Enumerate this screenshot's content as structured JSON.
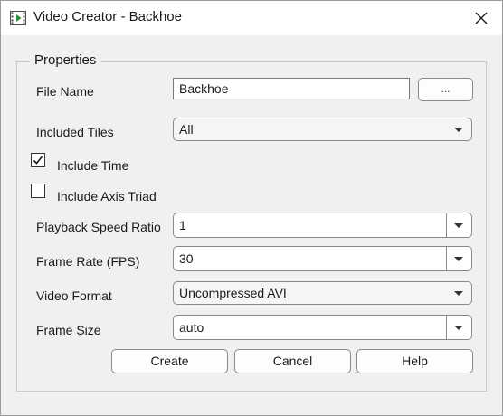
{
  "window": {
    "title": "Video Creator - Backhoe"
  },
  "group": {
    "title": "Properties"
  },
  "file_name": {
    "label": "File Name",
    "value": "Backhoe",
    "browse_label": "..."
  },
  "included_tiles": {
    "label": "Included Tiles",
    "selected": "All"
  },
  "include_time": {
    "label": "Include Time",
    "checked": true
  },
  "include_axis_triad": {
    "label": "Include Axis Triad",
    "checked": false
  },
  "playback_speed_ratio": {
    "label": "Playback Speed Ratio",
    "value": "1"
  },
  "frame_rate": {
    "label": "Frame Rate (FPS)",
    "value": "30"
  },
  "video_format": {
    "label": "Video Format",
    "selected": "Uncompressed AVI"
  },
  "frame_size": {
    "label": "Frame Size",
    "value": "auto"
  },
  "buttons": {
    "create": "Create",
    "cancel": "Cancel",
    "help": "Help"
  },
  "icons": {
    "app": "video-app-icon",
    "close": "close-icon",
    "check": "checkmark-icon",
    "dropdown": "chevron-down-icon"
  }
}
